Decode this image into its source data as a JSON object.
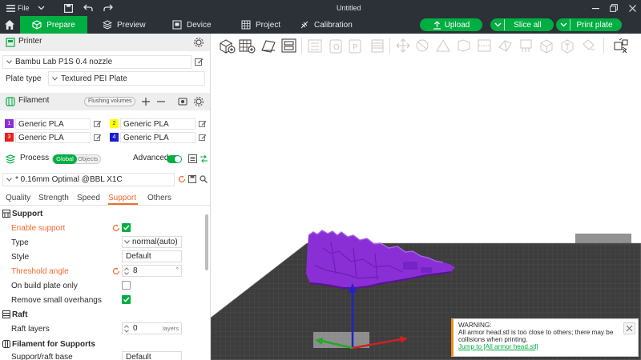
{
  "titlebar": {
    "file_label": "File",
    "title": "Untitled"
  },
  "nav": {
    "tabs": [
      "Prepare",
      "Preview",
      "Device",
      "Project",
      "Calibration"
    ],
    "upload_label": "Upload",
    "slice_label": "Slice all",
    "print_label": "Print plate"
  },
  "printer": {
    "header": "Printer",
    "name": "Bambu Lab P1S 0.4 nozzle",
    "plate_type_label": "Plate type",
    "plate_type_value": "Textured PEI Plate"
  },
  "filament": {
    "header": "Filament",
    "flushing_label": "Flushing volumes",
    "items": [
      {
        "num": "1",
        "name": "Generic PLA",
        "color": "#8b2fd6"
      },
      {
        "num": "2",
        "name": "Generic PLA",
        "color": "#ffff00"
      },
      {
        "num": "3",
        "name": "Generic PLA",
        "color": "#e81e1e"
      },
      {
        "num": "4",
        "name": "Generic PLA",
        "color": "#1a1ad6"
      }
    ]
  },
  "process": {
    "header": "Process",
    "global_label": "Global",
    "objects_label": "Objects",
    "advanced_label": "Advanced",
    "profile": "* 0.16mm Optimal @BBL X1C",
    "tabs": [
      "Quality",
      "Strength",
      "Speed",
      "Support",
      "Others"
    ],
    "active_tab": "Support"
  },
  "support": {
    "section": "Support",
    "enable_label": "Enable support",
    "enable_checked": true,
    "type_label": "Type",
    "type_value": "normal(auto)",
    "style_label": "Style",
    "style_value": "Default",
    "threshold_label": "Threshold angle",
    "threshold_value": "8",
    "threshold_unit": "°",
    "build_plate_label": "On build plate only",
    "build_plate_checked": false,
    "remove_overhangs_label": "Remove small overhangs",
    "remove_overhangs_checked": true
  },
  "raft": {
    "section": "Raft",
    "layers_label": "Raft layers",
    "layers_value": "0",
    "layers_unit": "layers"
  },
  "filament_supports": {
    "section": "Filament for Supports",
    "base_label": "Support/raft base",
    "base_value": "Default"
  },
  "warning": {
    "title": "WARNING:",
    "message_1": "All armor head.stl is too close to others; there may be",
    "message_2": "collisions when printing.",
    "link": "Jump to [All armor head.stl]"
  },
  "colors": {
    "accent": "#00ae42",
    "dark": "#2b3137",
    "model": "#8a2fd6",
    "warning": "#f06a2c"
  }
}
